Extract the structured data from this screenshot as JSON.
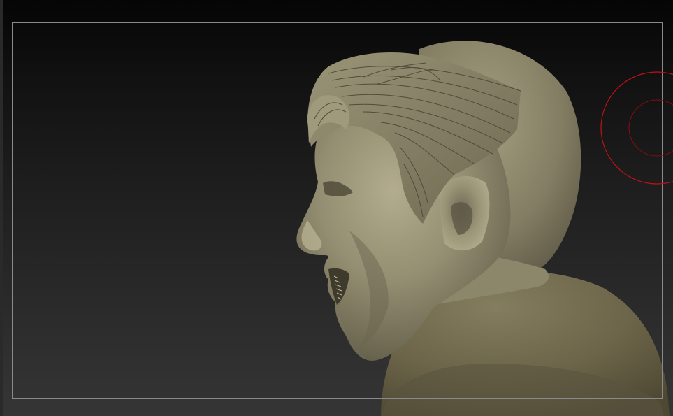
{
  "canvas": {
    "background_top": "#050505",
    "background_bottom": "#353535",
    "frame_color": "#8a8a8a"
  },
  "model": {
    "material_color": "#8f8a6e",
    "shadow_color": "#4a4636",
    "highlight_color": "#b7b092"
  },
  "brush": {
    "outer_color": "#c0101a",
    "inner_color": "#8a0c12"
  }
}
